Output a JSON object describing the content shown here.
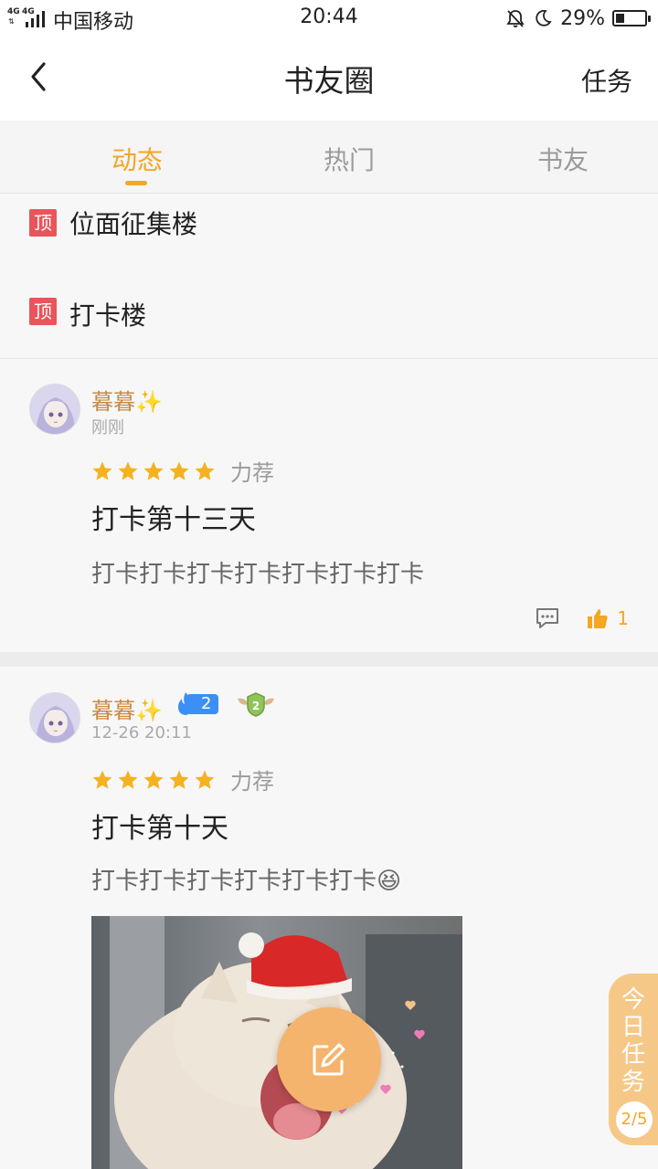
{
  "status_bar": {
    "network_label": "4G",
    "network_label_2": "4G",
    "carrier": "中国移动",
    "time": "20:44",
    "battery_percent": "29%",
    "battery_level": 0.29
  },
  "header": {
    "title": "书友圈",
    "task_label": "任务"
  },
  "tabs": [
    {
      "label": "动态",
      "active": true
    },
    {
      "label": "热门",
      "active": false
    },
    {
      "label": "书友",
      "active": false
    }
  ],
  "pinned": [
    {
      "badge": "顶",
      "text": "位面征集楼"
    },
    {
      "badge": "顶",
      "text": "打卡楼"
    }
  ],
  "posts": [
    {
      "username": "暮暮✨",
      "time": "刚刚",
      "rating": 5,
      "rating_label": "力荐",
      "title": "打卡第十三天",
      "body": "打卡打卡打卡打卡打卡打卡打卡",
      "likes": "1"
    },
    {
      "username": "暮暮✨",
      "fire_level": "2",
      "time": "12-26 20:11",
      "rating": 5,
      "rating_label": "力荐",
      "title": "打卡第十天",
      "body": "打卡打卡打卡打卡打卡打卡😆"
    }
  ],
  "floating": {
    "today_task_label": "今日任务",
    "today_task_count": "2/5"
  },
  "colors": {
    "accent": "#f5a623",
    "username": "#c98a45",
    "pin_badge": "#e8555a",
    "compose_button": "#f4b46d"
  }
}
